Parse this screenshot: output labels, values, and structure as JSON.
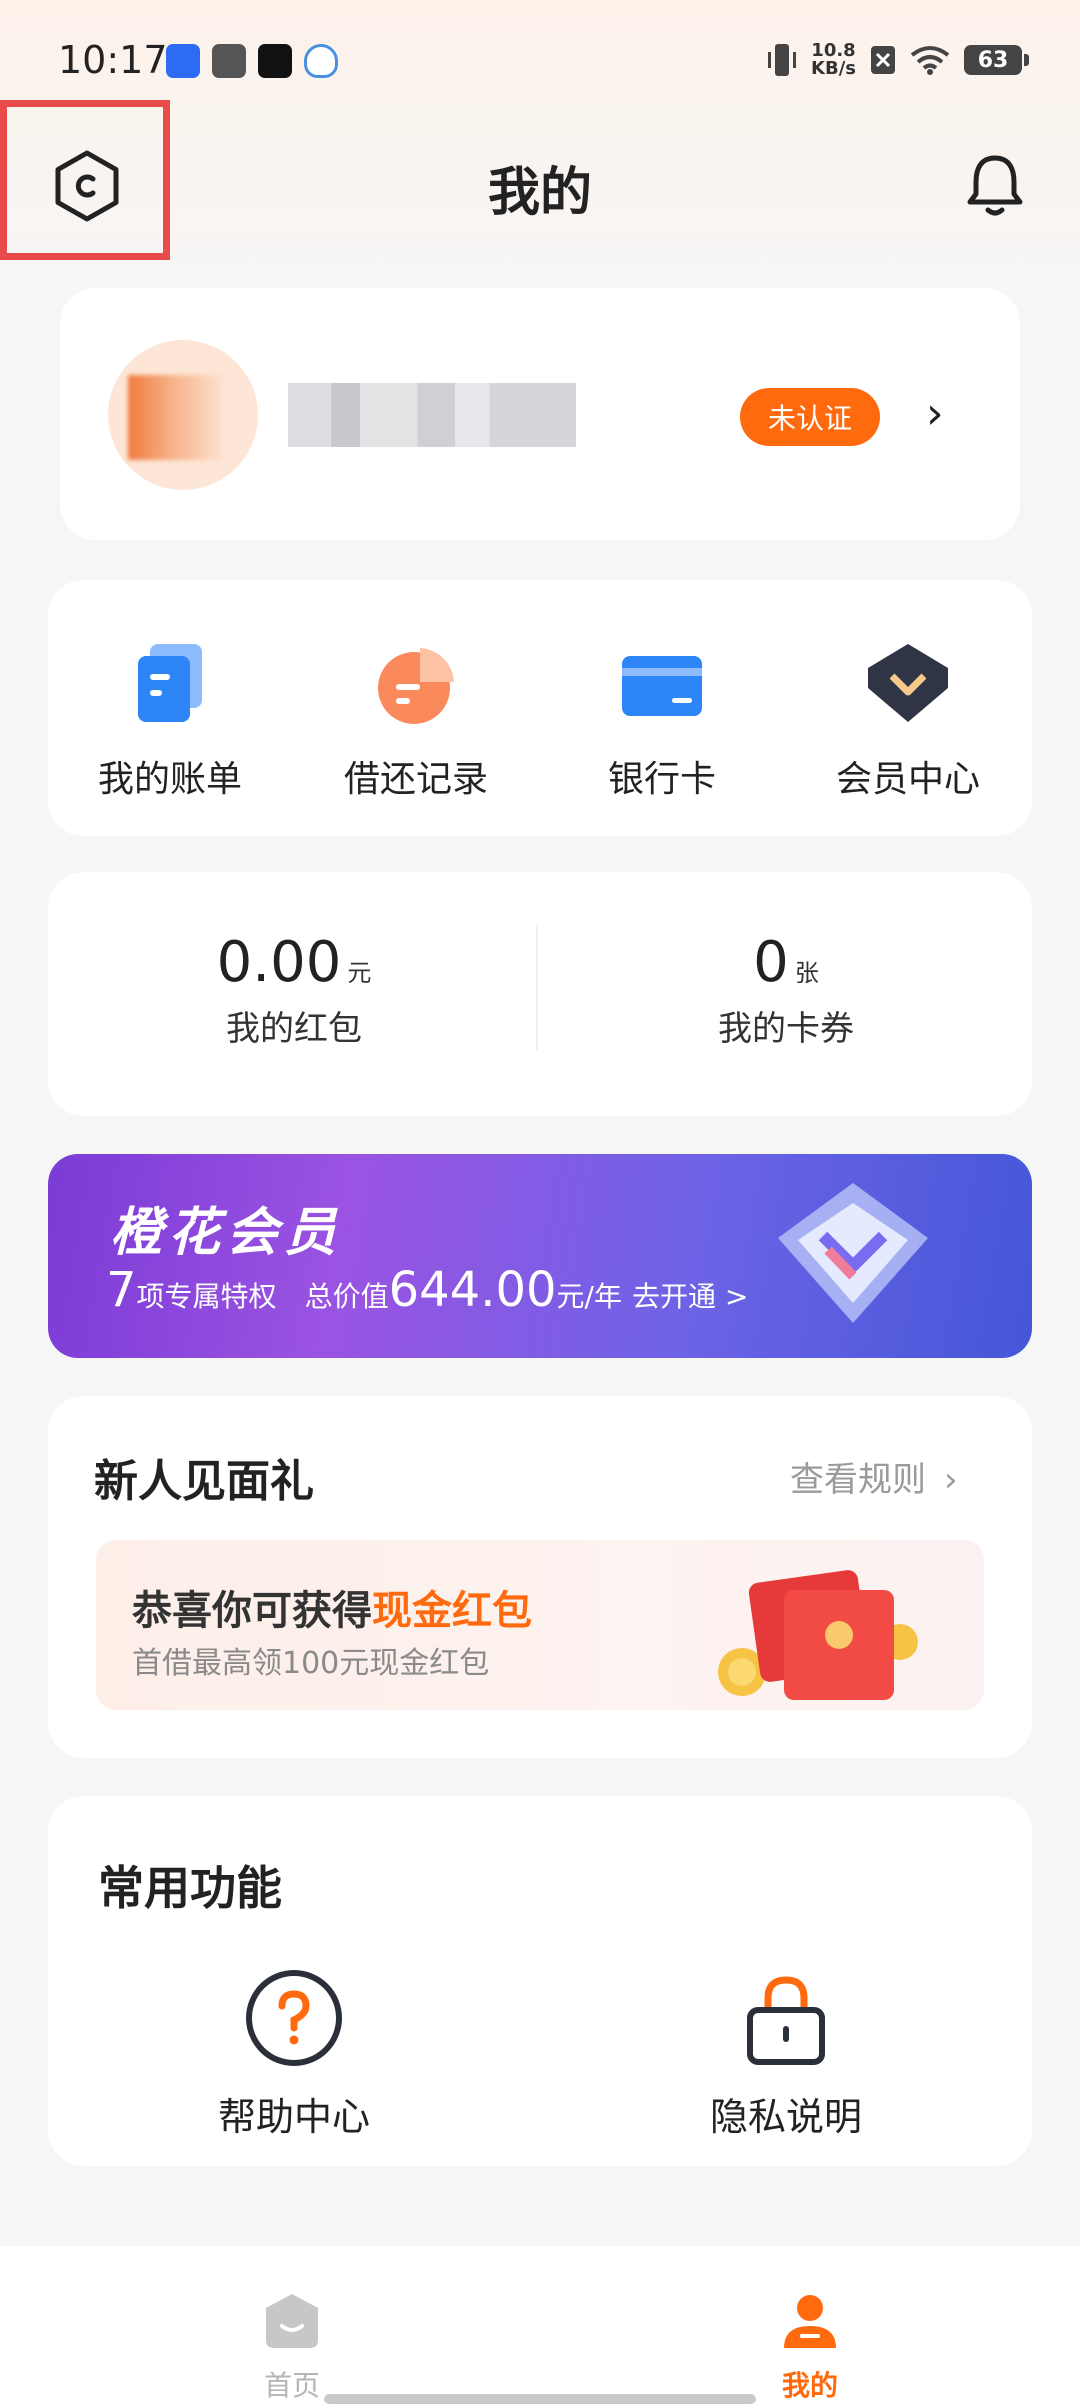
{
  "status_bar": {
    "time": "10:17",
    "net_speed_value": "10.8",
    "net_speed_unit": "KB/s",
    "battery": "63",
    "icons": [
      "app-notification-icon",
      "mail-icon",
      "tiktok-icon",
      "qq-icon",
      "vibrate-icon",
      "no-sim-icon",
      "wifi-icon",
      "battery-icon"
    ]
  },
  "header": {
    "title": "我的"
  },
  "profile": {
    "status_badge": "未认证"
  },
  "quick_menu": [
    {
      "label": "我的账单",
      "icon": "bill-icon"
    },
    {
      "label": "借还记录",
      "icon": "record-pie-icon"
    },
    {
      "label": "银行卡",
      "icon": "bank-card-icon"
    },
    {
      "label": "会员中心",
      "icon": "vip-center-icon"
    }
  ],
  "wallet": {
    "red_packet": {
      "value": "0.00",
      "unit": "元",
      "label": "我的红包"
    },
    "coupons": {
      "value": "0",
      "unit": "张",
      "label": "我的卡券"
    }
  },
  "vip_banner": {
    "title": "橙花会员",
    "count": "7",
    "privilege_text": "项专属特权",
    "total_label": "总价值",
    "total_value": "644.00",
    "total_unit": "元/年",
    "cta": "去开通 >"
  },
  "new_user_gift": {
    "title": "新人见面礼",
    "rules_link": "查看规则",
    "main_text": "恭喜你可获得",
    "highlight": "现金红包",
    "desc": "首借最高领100元现金红包"
  },
  "common_functions": {
    "title": "常用功能",
    "items": [
      {
        "label": "帮助中心",
        "icon": "help-icon"
      },
      {
        "label": "隐私说明",
        "icon": "lock-icon"
      }
    ]
  },
  "bottom_nav": {
    "items": [
      {
        "label": "首页",
        "icon": "home-icon",
        "active": false
      },
      {
        "label": "我的",
        "icon": "profile-icon",
        "active": true
      }
    ],
    "active_color": "#ff6a0f",
    "inactive_color": "#b5b5b5"
  },
  "colors": {
    "accent": "#ff6a0f",
    "highlight_border": "#e94b4b"
  }
}
